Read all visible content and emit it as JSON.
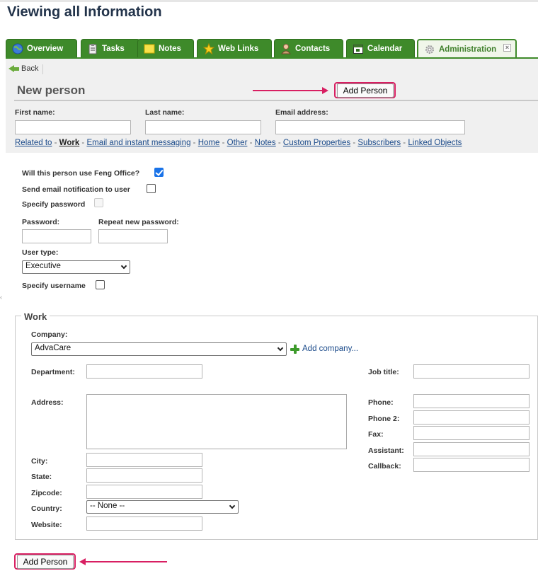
{
  "page": {
    "title": "Viewing all Information"
  },
  "tabs": [
    {
      "label": "Overview",
      "icon": "globe-icon"
    },
    {
      "label": "Tasks",
      "icon": "clipboard-icon"
    },
    {
      "label": "Notes",
      "icon": "sticky-note-icon"
    },
    {
      "label": "Web Links",
      "icon": "star-icon"
    },
    {
      "label": "Contacts",
      "icon": "person-icon"
    },
    {
      "label": "Calendar",
      "icon": "calendar-icon"
    },
    {
      "label": "Administration",
      "icon": "gear-icon",
      "active": true
    }
  ],
  "toolbar": {
    "back_label": "Back"
  },
  "form": {
    "title": "New person",
    "submit_label": "Add Person",
    "fields": {
      "first_name": "First name:",
      "last_name": "Last name:",
      "email": "Email address:"
    },
    "links": [
      "Related to",
      "Work",
      "Email and instant messaging",
      "Home",
      "Other",
      "Notes",
      "Custom Properties",
      "Subscribers",
      "Linked Objects"
    ],
    "account": {
      "use_feng": "Will this person use Feng Office?",
      "send_email": "Send email notification to user",
      "specify_password": "Specify password",
      "password": "Password:",
      "repeat_password": "Repeat new password:",
      "user_type": "User type:",
      "user_type_value": "Executive",
      "specify_username": "Specify username"
    },
    "work": {
      "legend": "Work",
      "company": "Company:",
      "company_value": "AdvaCare",
      "add_company": "Add company...",
      "department": "Department:",
      "job_title": "Job title:",
      "address": "Address:",
      "phone": "Phone:",
      "phone2": "Phone 2:",
      "fax": "Fax:",
      "assistant": "Assistant:",
      "callback": "Callback:",
      "city": "City:",
      "state": "State:",
      "zipcode": "Zipcode:",
      "country": "Country:",
      "country_value": "-- None --",
      "website": "Website:"
    }
  },
  "colors": {
    "tab_green": "#3e8a2a",
    "highlight": "#d81f62"
  }
}
